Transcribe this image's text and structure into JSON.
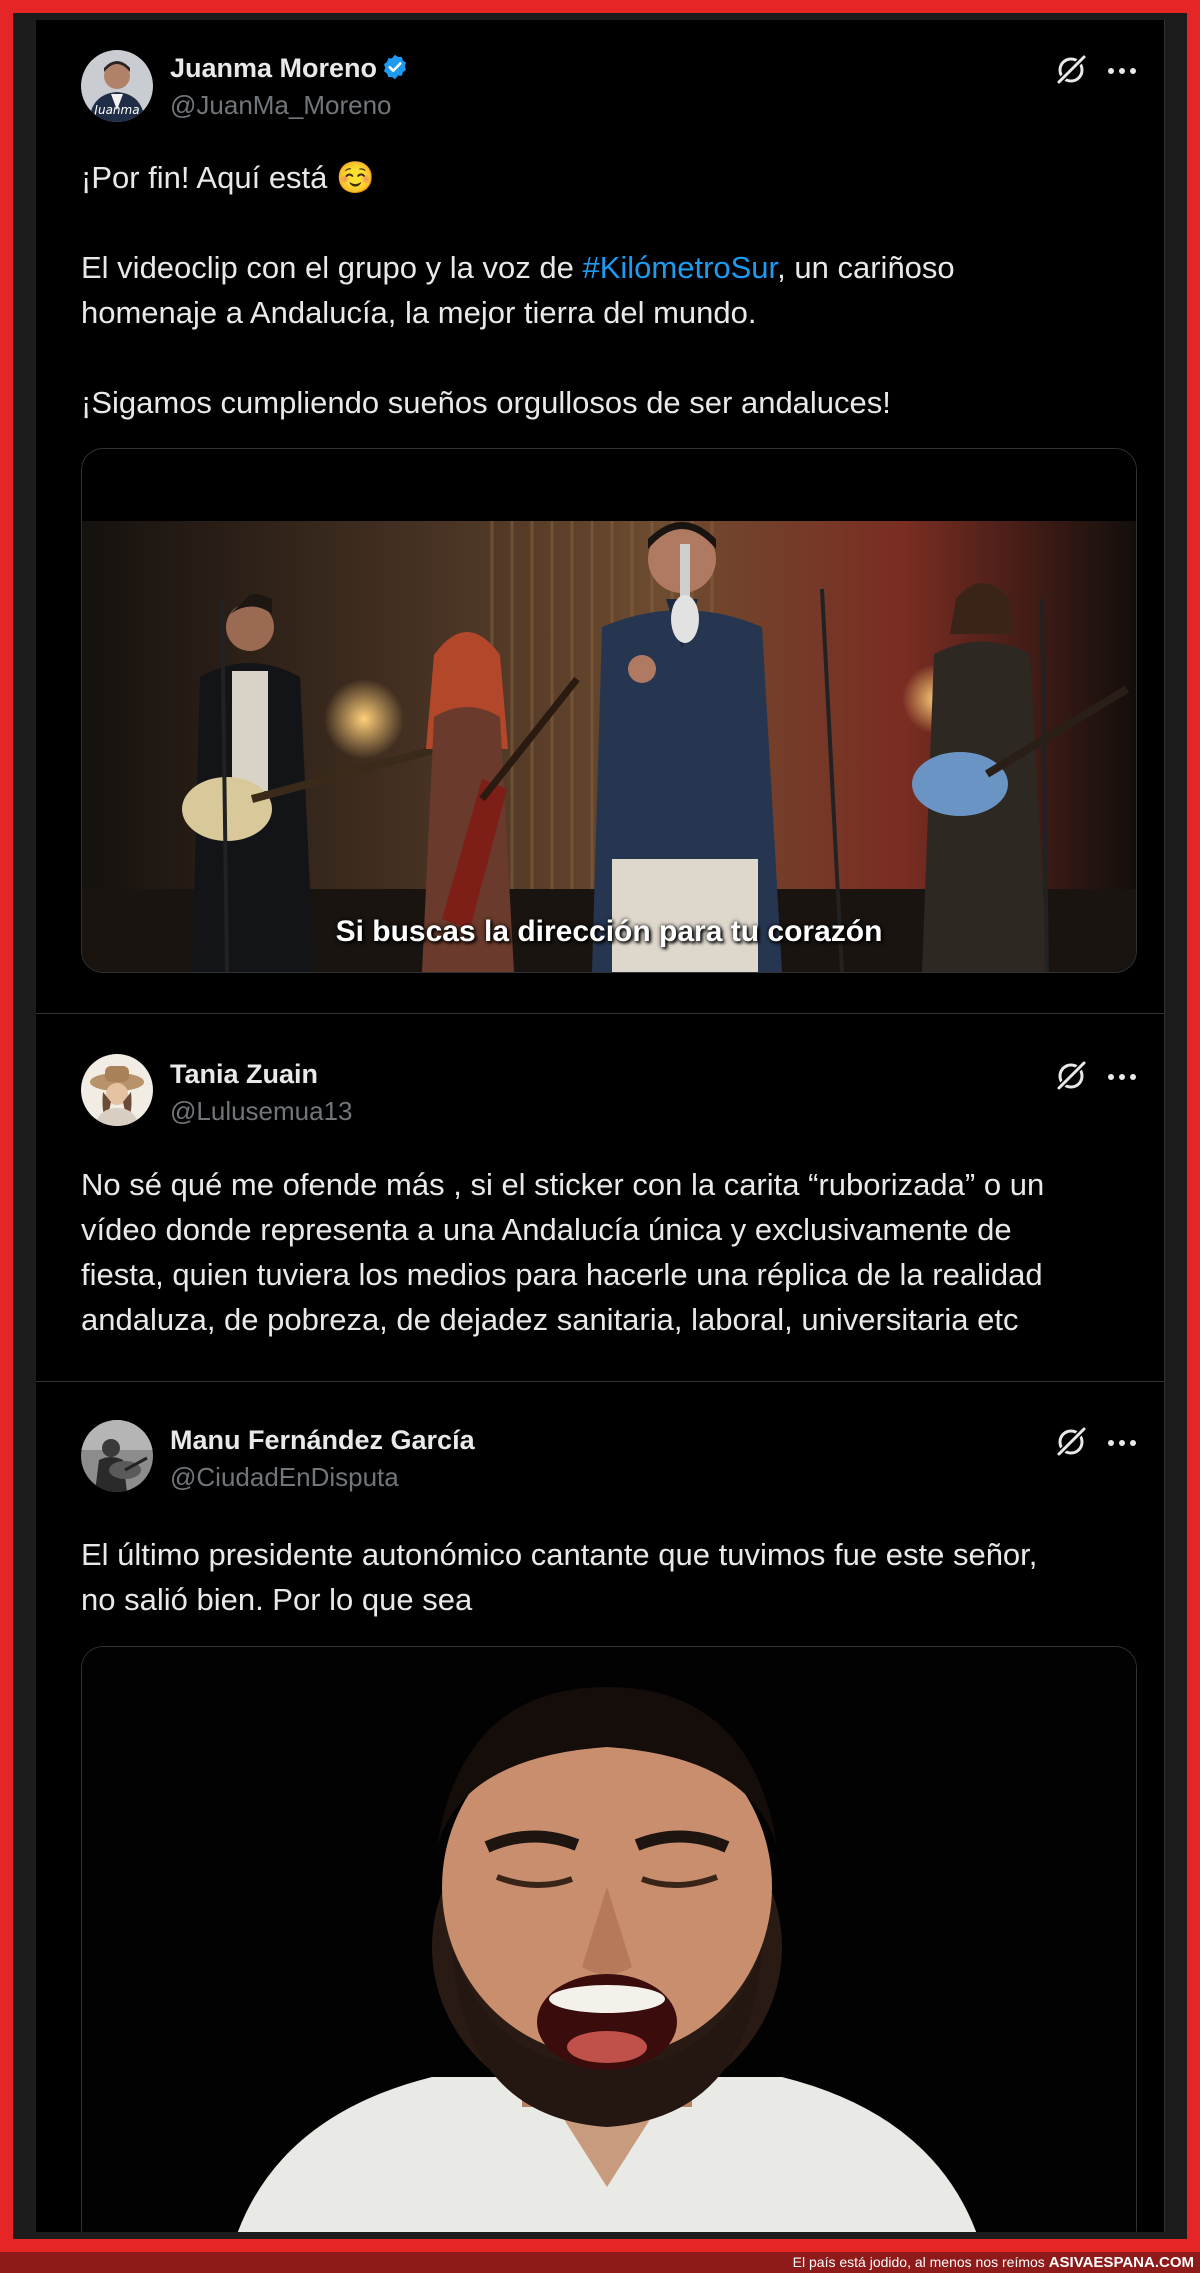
{
  "posts": [
    {
      "name": "Juanma Moreno",
      "handle": "@JuanMa_Moreno",
      "avatar_caption": "Juanma",
      "text_before": "¡Por fin! Aquí está ☺️\n\nEl videoclip con el grupo y la voz de ",
      "hashtag": "#KilómetroSur",
      "text_after": ", un cariñoso\nhomenaje a Andalucía, la mejor tierra del mundo.\n\n¡Sigamos cumpliendo sueños orgullosos de ser andaluces!",
      "video_subtitle": "Si buscas la dirección para tu corazón"
    },
    {
      "name": "Tania Zuain",
      "handle": "@Lulusemua13",
      "text": "No sé qué me ofende más , si el sticker con la carita “ruborizada” o un\nvídeo donde representa a una Andalucía única y exclusivamente de\nfiesta, quien tuviera los medios para hacerle una réplica de la realidad\nandaluza, de pobreza, de dejadez sanitaria, laboral, universitaria etc"
    },
    {
      "name": "Manu Fernández García",
      "handle": "@CiudadEnDisputa",
      "text": "El último presidente autonómico cantante que tuvimos fue este señor,\nno salió bien. Por lo que sea"
    }
  ],
  "icons": {
    "verified": "verified-badge-icon",
    "grok": "grok-icon",
    "more": "more-options-icon"
  },
  "colors": {
    "frame": "#e52526",
    "background": "#000000",
    "text": "#e7e9ea",
    "secondary": "#71767b",
    "link": "#1d9bf0",
    "verified": "#1d9bf0"
  },
  "watermark": {
    "caption": "El país está jodido, al menos nos reímos ",
    "site": "ASIVAESPANA.COM"
  }
}
